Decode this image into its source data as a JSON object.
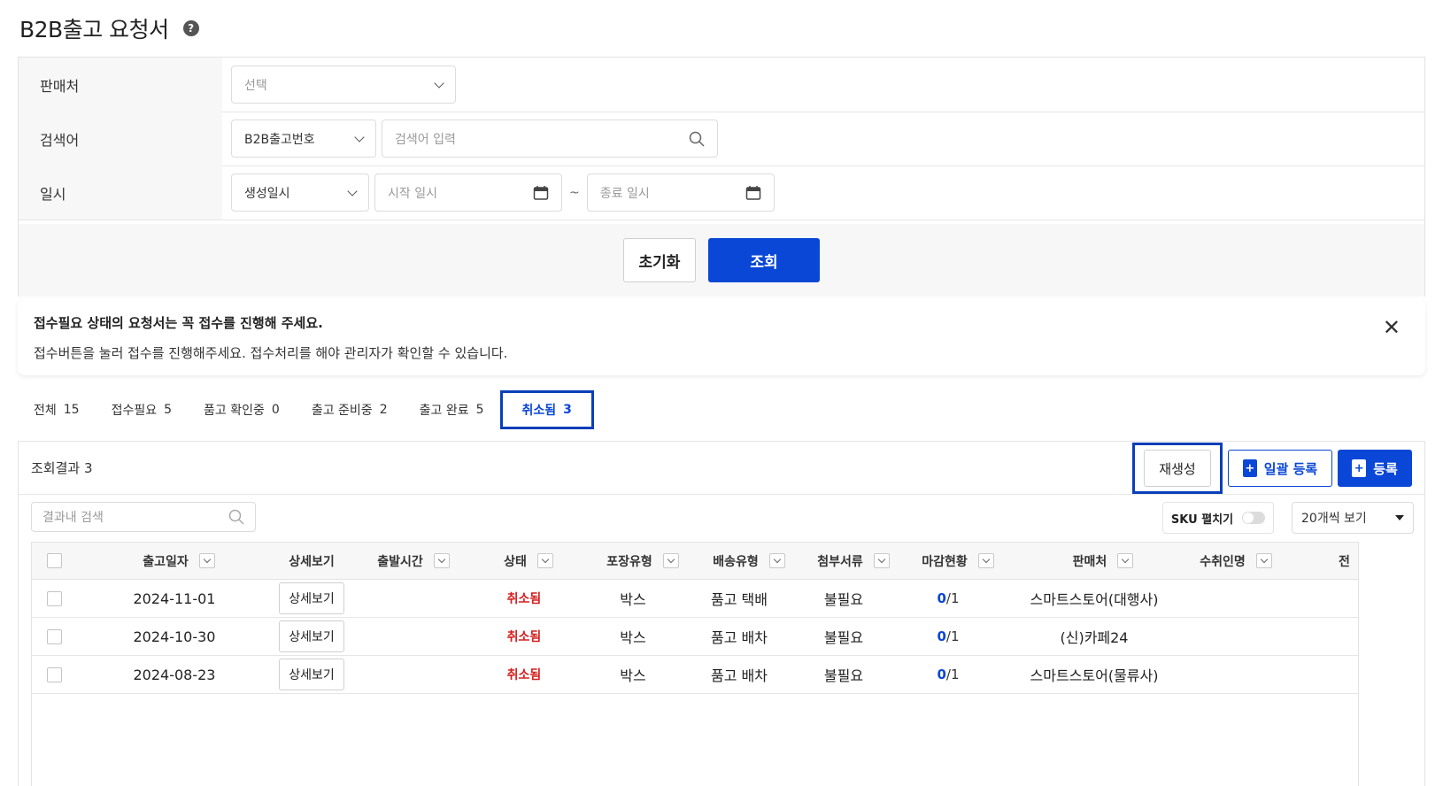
{
  "page": {
    "title": "B2B출고 요청서"
  },
  "filters": {
    "seller": {
      "label": "판매처",
      "placeholder": "선택"
    },
    "keyword": {
      "label": "검색어",
      "type_value": "B2B출고번호",
      "placeholder": "검색어 입력"
    },
    "date": {
      "label": "일시",
      "type_value": "생성일시",
      "start_placeholder": "시작 일시",
      "separator": "~",
      "end_placeholder": "종료 일시"
    },
    "reset_label": "초기화",
    "search_label": "조회"
  },
  "notice": {
    "title": "접수필요 상태의 요청서는 꼭 접수를 진행해 주세요.",
    "body": "접수버튼을 눌러 접수를 진행해주세요. 접수처리를 해야 관리자가 확인할 수 있습니다."
  },
  "tabs": [
    {
      "label": "전체",
      "count": "15"
    },
    {
      "label": "접수필요",
      "count": "5"
    },
    {
      "label": "품고 확인중",
      "count": "0"
    },
    {
      "label": "출고 준비중",
      "count": "2"
    },
    {
      "label": "출고 완료",
      "count": "5"
    },
    {
      "label": "취소됨",
      "count": "3",
      "active": true
    }
  ],
  "results": {
    "count_label": "조회결과 3",
    "regen_label": "재생성",
    "bulk_label": "일괄 등록",
    "register_label": "등록",
    "search_placeholder": "결과내 검색",
    "sku_label": "SKU 펼치기",
    "page_size": "20개씩 보기"
  },
  "table": {
    "headers": [
      "출고일자",
      "상세보기",
      "출발시간",
      "상태",
      "포장유형",
      "배송유형",
      "첨부서류",
      "마감현황",
      "판매처",
      "수취인명",
      "전"
    ],
    "rows": [
      {
        "date": "2024-11-01",
        "detail": "상세보기",
        "status": "취소됨",
        "pack": "박스",
        "ship": "품고 택배",
        "docs": "불필요",
        "done": "0",
        "total": "/1",
        "seller": "스마트스토어(대행사)"
      },
      {
        "date": "2024-10-30",
        "detail": "상세보기",
        "status": "취소됨",
        "pack": "박스",
        "ship": "품고 배차",
        "docs": "불필요",
        "done": "0",
        "total": "/1",
        "seller": "(신)카페24"
      },
      {
        "date": "2024-08-23",
        "detail": "상세보기",
        "status": "취소됨",
        "pack": "박스",
        "ship": "품고 배차",
        "docs": "불필요",
        "done": "0",
        "total": "/1",
        "seller": "스마트스토어(물류사)"
      }
    ]
  },
  "colors": {
    "primary": "#0a47d6",
    "highlight": "#0a3fb8",
    "cancel": "#d62020"
  }
}
